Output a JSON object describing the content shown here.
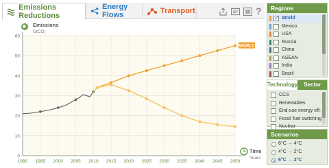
{
  "tabs": [
    {
      "label": "Emissions Reductions",
      "color": "#5d8a39",
      "active": true
    },
    {
      "label": "Energy Flows",
      "color": "#2a7cc0",
      "active": false
    },
    {
      "label": "Transport",
      "color": "#e05a1e",
      "active": false
    }
  ],
  "toolbar": {
    "help": "?"
  },
  "chart_data": {
    "type": "line",
    "ylabel": "Emissions",
    "yunit": "GtCO₂",
    "xlabel": "Time",
    "xunit": "Years",
    "ylim": [
      0,
      60
    ],
    "yticks": [
      "0",
      "10",
      "20",
      "30",
      "40",
      "50",
      "60"
    ],
    "xlim": [
      1990,
      2050
    ],
    "xticks": [
      "1990",
      "1995",
      "2000",
      "2005",
      "2010",
      "2015",
      "2020",
      "2025",
      "2030",
      "2035",
      "2040",
      "2045",
      "2050"
    ],
    "grid": true,
    "historical": {
      "x": [
        1990,
        1992,
        1995,
        1998,
        2000,
        2002,
        2004,
        2005,
        2006,
        2007,
        2008,
        2009,
        2010
      ],
      "y": [
        21,
        21.2,
        22,
        23,
        24,
        25,
        27,
        28,
        29,
        30.5,
        30,
        29.5,
        32
      ],
      "markers": [
        1995,
        2000,
        2005,
        2010
      ],
      "color": "#666666"
    },
    "series": [
      {
        "name": "WORLD",
        "color": "#f0a032",
        "x": [
          2010,
          2011,
          2015,
          2020,
          2025,
          2030,
          2035,
          2040,
          2045,
          2050
        ],
        "y": [
          32,
          34,
          36.5,
          40,
          42.5,
          45,
          47.5,
          50,
          52.5,
          55
        ]
      },
      {
        "color": "#f7c060",
        "x": [
          2010,
          2011,
          2015,
          2020,
          2025,
          2030,
          2035,
          2040,
          2045,
          2050
        ],
        "y": [
          32,
          34,
          35.5,
          32.5,
          28.5,
          24,
          20,
          17,
          15.5,
          14.5
        ]
      }
    ]
  },
  "regions": {
    "title": "Regions",
    "items": [
      {
        "label": "World",
        "color": "#f0a032",
        "checked": true,
        "selected": true
      },
      {
        "label": "Mexico",
        "color": "#6aa6d6",
        "checked": false,
        "selected": false
      },
      {
        "label": "USA",
        "color": "#e8883a",
        "checked": false,
        "selected": false
      },
      {
        "label": "Russia",
        "color": "#3b8c6e",
        "checked": false,
        "selected": false
      },
      {
        "label": "China",
        "color": "#4f6d8c",
        "checked": false,
        "selected": false
      },
      {
        "label": "ASEAN",
        "color": "#b7a06a",
        "checked": false,
        "selected": false
      },
      {
        "label": "India",
        "color": "#9c7cc4",
        "checked": false,
        "selected": false
      },
      {
        "label": "Brazil",
        "color": "#9e4f4f",
        "checked": false,
        "selected": false
      }
    ]
  },
  "technology": {
    "tab_on": "Technology",
    "tab_off": "Sector",
    "items": [
      {
        "label": "CCS"
      },
      {
        "label": "Renewables"
      },
      {
        "label": "End-use energy eff."
      },
      {
        "label": "Fossil fuel switching"
      },
      {
        "label": "Nuclear"
      }
    ]
  },
  "scenarios": {
    "title": "Scenarios",
    "items": [
      {
        "label": "6°C → 4°C",
        "checked": false
      },
      {
        "label": "4°C → 2°C",
        "checked": false
      },
      {
        "label": "6°C → 2°C",
        "checked": true
      }
    ]
  }
}
